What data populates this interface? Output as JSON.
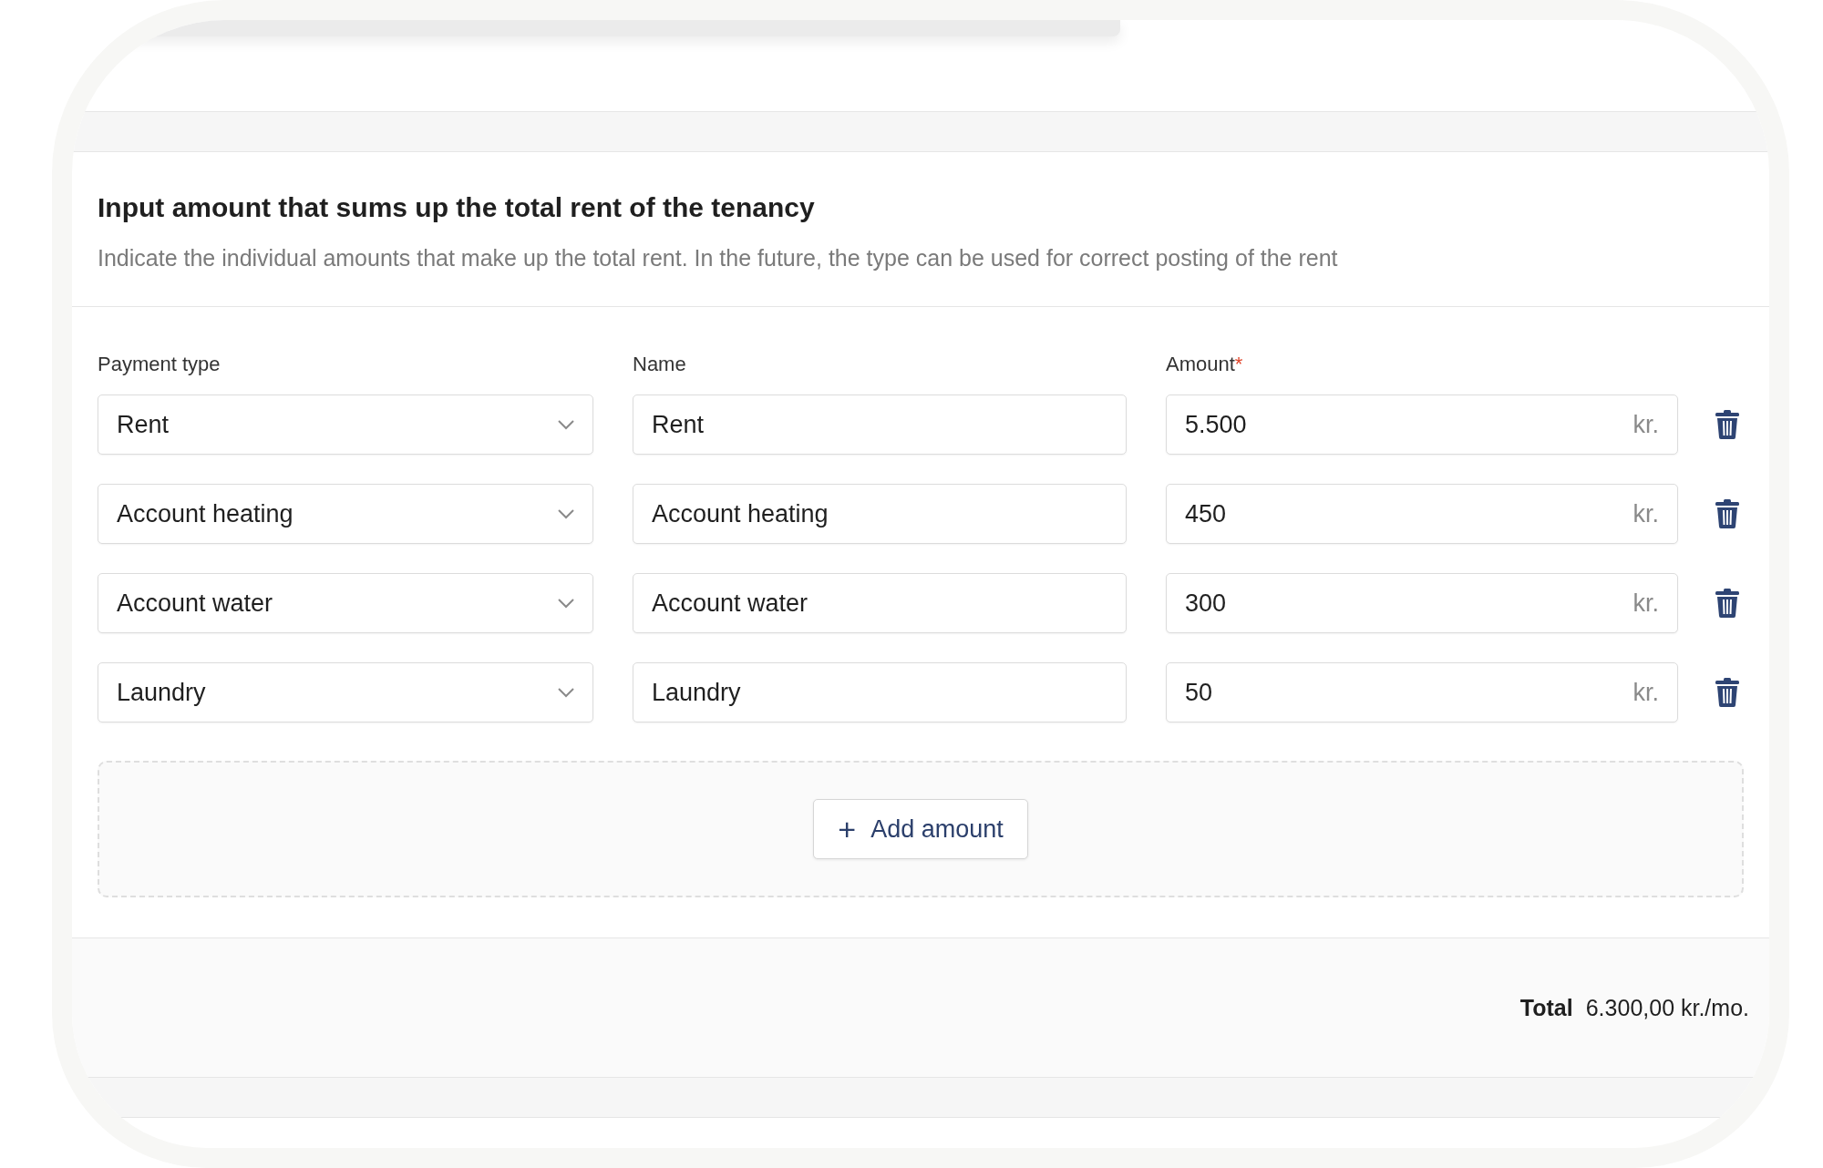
{
  "section": {
    "title": "Input amount that sums up the total rent of the tenancy",
    "description": "Indicate the individual amounts that make up the total rent. In the future, the type can be used for correct posting of the rent"
  },
  "columns": [
    {
      "label": "Payment type"
    },
    {
      "label": "Name"
    },
    {
      "label": "Amount",
      "required_mark": "*"
    }
  ],
  "rows": [
    {
      "payment_type": "Rent",
      "name": "Rent",
      "amount": "5.500",
      "unit": "kr."
    },
    {
      "payment_type": "Account heating",
      "name": "Account heating",
      "amount": "450",
      "unit": "kr."
    },
    {
      "payment_type": "Account water",
      "name": "Account water",
      "amount": "300",
      "unit": "kr."
    },
    {
      "payment_type": "Laundry",
      "name": "Laundry",
      "amount": "50",
      "unit": "kr."
    }
  ],
  "add_button": {
    "icon": "+",
    "label": "Add amount"
  },
  "total": {
    "label": "Total",
    "value": "6.300,00 kr./mo."
  }
}
